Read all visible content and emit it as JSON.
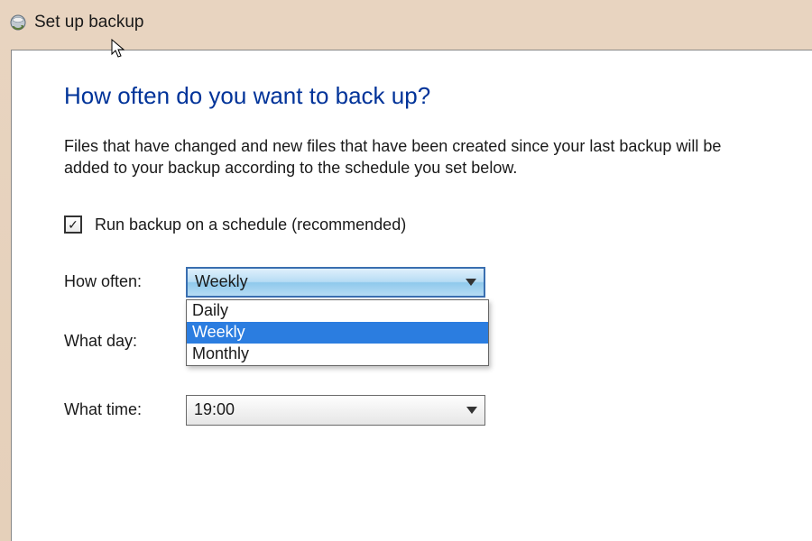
{
  "window": {
    "title": "Set up backup"
  },
  "page": {
    "heading": "How often do you want to back up?",
    "description": "Files that have changed and new files that have been created since your last backup will be added to your backup according to the schedule you set below."
  },
  "schedule_checkbox": {
    "label": "Run backup on a schedule (recommended)",
    "checked": true
  },
  "fields": {
    "how_often": {
      "label": "How often:",
      "value": "Weekly",
      "options": [
        "Daily",
        "Weekly",
        "Monthly"
      ],
      "selected_index": 1,
      "open": true
    },
    "what_day": {
      "label": "What day:",
      "value": ""
    },
    "what_time": {
      "label": "What time:",
      "value": "19:00"
    }
  }
}
